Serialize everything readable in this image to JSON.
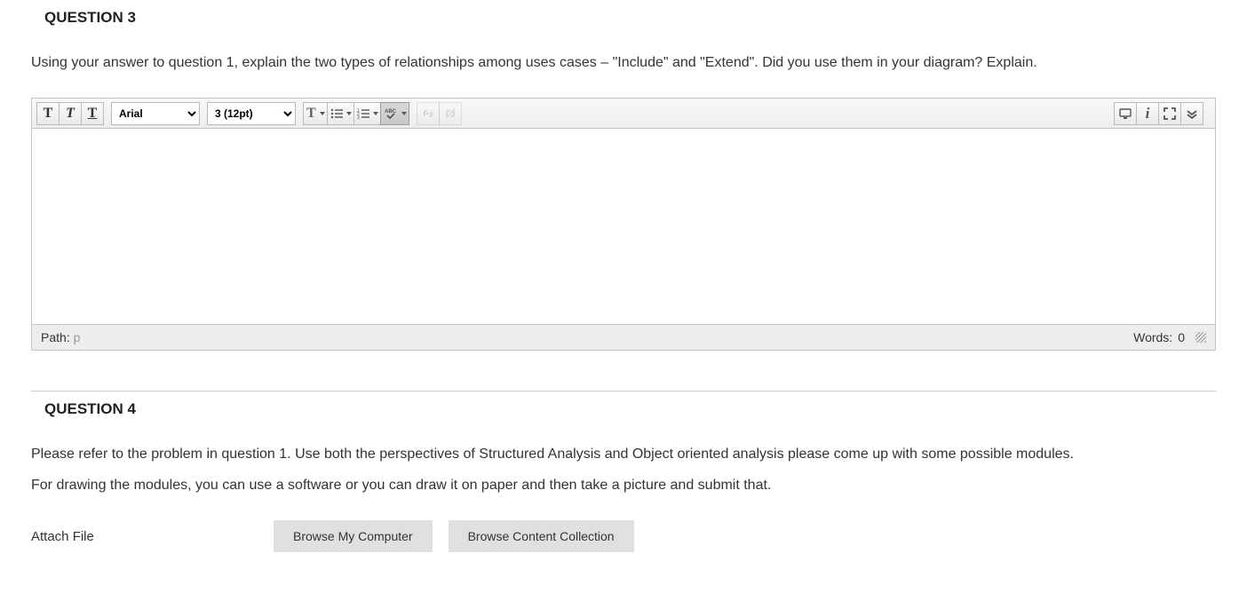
{
  "q3": {
    "title": "QUESTION 3",
    "text": "Using your answer to question 1, explain the two types of relationships among uses cases – \"Include\" and \"Extend\".   Did you use them in your diagram? Explain."
  },
  "editor": {
    "font_family": "Arial",
    "font_size": "3 (12pt)",
    "path_label": "Path: ",
    "path_tag": "p",
    "words_label": "Words:",
    "words_count": "0"
  },
  "q4": {
    "title": "QUESTION 4",
    "text1": "Please refer to the problem in question 1. Use both the perspectives of Structured Analysis and Object oriented analysis please come up with some possible modules.",
    "text2": "For drawing the modules, you can use a software or you can draw it on paper and then take a picture and submit that.",
    "attach_label": "Attach File",
    "browse_computer": "Browse My Computer",
    "browse_collection": "Browse Content Collection"
  }
}
